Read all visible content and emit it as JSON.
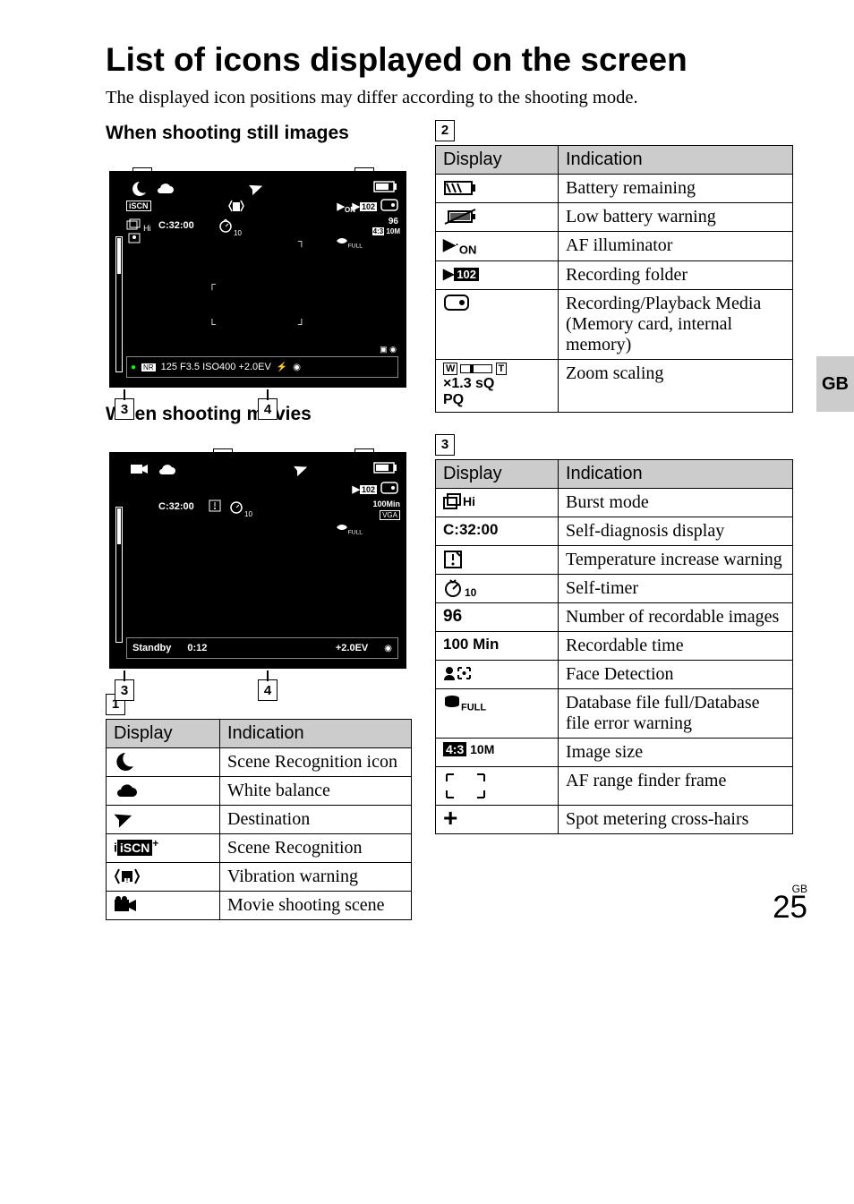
{
  "title": "List of icons displayed on the screen",
  "intro": "The displayed icon positions may differ according to the shooting mode.",
  "headings": {
    "stills": "When shooting still images",
    "movies": "When shooting movies"
  },
  "side_tab": "GB",
  "page_number": "25",
  "page_number_prefix": "GB",
  "table_headers": {
    "display": "Display",
    "indication": "Indication"
  },
  "callout_labels": {
    "one": "1",
    "two": "2",
    "three": "3",
    "four": "4"
  },
  "lcd_still": {
    "iscn": "iSCN",
    "selfdiag": "C:32:00",
    "hi": "Hi",
    "eon": "ON",
    "folder": "102",
    "count": "96",
    "size": "4:3 10M",
    "full": "FULL",
    "bar": "125   F3.5   ISO400  +2.0EV"
  },
  "lcd_movie": {
    "selfdiag": "C:32:00",
    "folder": "102",
    "time": "100Min",
    "vga": "VGA",
    "full": "FULL",
    "standby": "Standby",
    "elapsed": "0:12",
    "ev": "+2.0EV"
  },
  "table1": [
    {
      "icon": "moon",
      "ind": "Scene Recognition icon"
    },
    {
      "icon": "cloud",
      "ind": "White balance"
    },
    {
      "icon": "plane",
      "ind": "Destination"
    },
    {
      "icon": "iscn",
      "ind": "Scene Recognition",
      "text": "iSCN"
    },
    {
      "icon": "vib",
      "ind": "Vibration warning"
    },
    {
      "icon": "moviecam",
      "ind": "Movie shooting scene"
    }
  ],
  "table2": [
    {
      "icon": "batt",
      "ind": "Battery remaining"
    },
    {
      "icon": "lowbatt",
      "ind": "Low battery warning"
    },
    {
      "icon": "afill",
      "ind": "AF illuminator",
      "text": "ON"
    },
    {
      "icon": "folder",
      "ind": "Recording folder",
      "text": "102"
    },
    {
      "icon": "card",
      "ind": "Recording/Playback Media (Memory card, internal memory)"
    },
    {
      "icon": "zoom",
      "ind": "Zoom scaling",
      "lines": [
        "×1.3 sQ",
        "PQ"
      ],
      "zoombar": {
        "w": "W",
        "t": "T"
      }
    }
  ],
  "table3": [
    {
      "icon": "burst",
      "ind": "Burst mode",
      "suffix": "Hi"
    },
    {
      "icon": "selfdiag",
      "ind": "Self-diagnosis display",
      "text": "C:32:00"
    },
    {
      "icon": "temp",
      "ind": "Temperature increase warning"
    },
    {
      "icon": "selft",
      "ind": "Self-timer"
    },
    {
      "icon": "num",
      "ind": "Number of recordable images",
      "text": "96"
    },
    {
      "icon": "rectime",
      "ind": "Recordable time",
      "text": "100 Min"
    },
    {
      "icon": "face",
      "ind": "Face Detection"
    },
    {
      "icon": "dbfull",
      "ind": "Database file full/Database file error warning",
      "text": "FULL"
    },
    {
      "icon": "imgsize",
      "ind": "Image size",
      "text": "4:3 10M"
    },
    {
      "icon": "afframe",
      "ind": "AF range finder frame"
    },
    {
      "icon": "cross",
      "ind": "Spot metering cross-hairs",
      "text": "+"
    }
  ]
}
